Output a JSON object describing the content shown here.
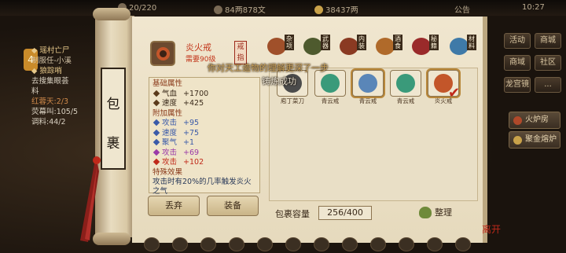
{
  "topbar": {
    "energy": "20/220",
    "money": "84两878文",
    "silver": "38437两",
    "announce": "公告",
    "clock": "10:27"
  },
  "quest": {
    "badge": "4",
    "lines": [
      {
        "text": "◆ 瑶村亡尸",
        "style": "hd"
      },
      {
        "text": "制服任-小溪",
        "style": "sub"
      },
      {
        "text": "◆ 狼踪哨",
        "style": "hd"
      },
      {
        "text": "去搜集眼荟",
        "style": "wh"
      },
      {
        "text": "料",
        "style": "wh"
      },
      {
        "text": "红蓉天:2/3",
        "style": "red"
      },
      {
        "text": "荧幕叫:105/5",
        "style": "wh"
      },
      {
        "text": "调料:44/2",
        "style": "wh"
      }
    ]
  },
  "side_menu": {
    "buttons": [
      "活动",
      "商城",
      "商域",
      "社区",
      "龙宫镜",
      "..."
    ],
    "wide_buttons": [
      "火炉房",
      "聚金熔炉"
    ]
  },
  "scroll": {
    "title_chars": [
      "包",
      "裹"
    ]
  },
  "item": {
    "name": "炎火戒",
    "requirement": "需要90级",
    "tag": "戒指"
  },
  "categories": [
    {
      "label": "杂项",
      "color": "#a0502a"
    },
    {
      "label": "武器",
      "color": "#4e5a2e"
    },
    {
      "label": "内装",
      "color": "#8a3a22"
    },
    {
      "label": "酒食",
      "color": "#b06a2a"
    },
    {
      "label": "秘籍",
      "color": "#9a2a2a"
    },
    {
      "label": "材料",
      "color": "#3f7aa8"
    }
  ],
  "attributes": {
    "base_title": "基础属性",
    "base": [
      {
        "name": "气血",
        "value": "+1700"
      },
      {
        "name": "速度",
        "value": "+425"
      }
    ],
    "extra_title": "附加属性",
    "extra": [
      {
        "name": "攻击",
        "value": "+95",
        "color": "#3a5aa8"
      },
      {
        "name": "速度",
        "value": "+75",
        "color": "#3a5aa8"
      },
      {
        "name": "聚气",
        "value": "+1",
        "color": "#3a5aa8"
      },
      {
        "name": "攻击",
        "value": "+69",
        "color": "#9a3aa8"
      },
      {
        "name": "攻击",
        "value": "+102",
        "color": "#c0291a"
      }
    ],
    "effect_title": "特殊效果",
    "effect_text": "攻击时有20%的几率触发炎火之气"
  },
  "messages": {
    "line1": "你对天工造物的理解更深了一步",
    "line2": "铸炼成功"
  },
  "inventory": {
    "items": [
      {
        "label": "庖丁菜刀",
        "color": "#4b4b4b"
      },
      {
        "label": "青云戒",
        "color": "#3a9a7a"
      },
      {
        "label": "青云戒",
        "color": "#5a86b8"
      },
      {
        "label": "青云戒",
        "color": "#3a9a7a"
      },
      {
        "label": "炎火戒",
        "color": "#c3562a"
      }
    ],
    "capacity_label": "包裹容量",
    "capacity_value": "256/400",
    "sort_label": "整理"
  },
  "actions": {
    "discard": "丢弃",
    "equip": "装备"
  },
  "close_label": "离开"
}
